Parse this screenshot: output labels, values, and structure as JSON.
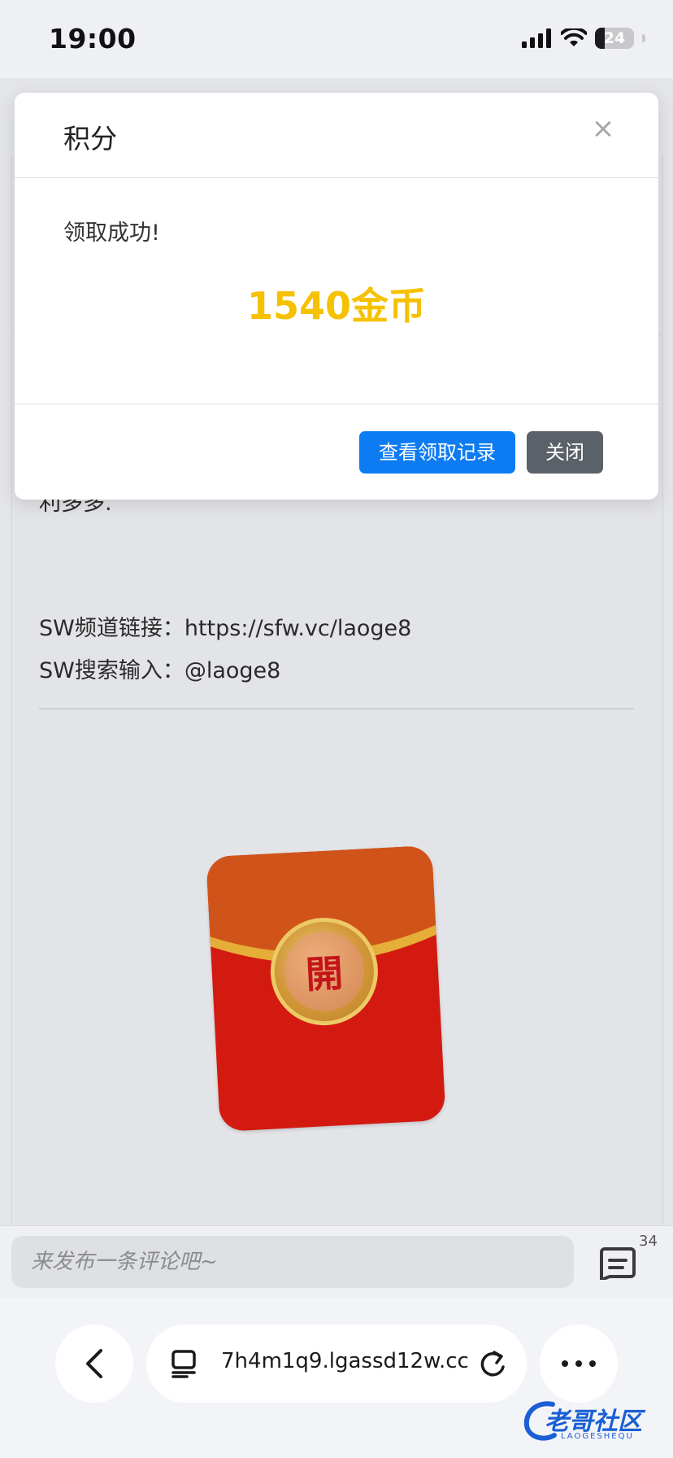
{
  "status_bar": {
    "time": "19:00",
    "battery": "24",
    "battery_level": 0.24
  },
  "page": {
    "partial_text": "利多多.",
    "lines": [
      "SW频道链接：https://sfw.vc/laoge8",
      "SW搜索输入：@laoge8"
    ],
    "envelope_glyph": "開"
  },
  "modal": {
    "title": "积分",
    "close_symbol": "×",
    "message": "领取成功!",
    "amount": "1540金币",
    "primary_button": "查看领取记录",
    "secondary_button": "关闭",
    "accent_color": "#f5c100",
    "primary_color": "#0d7cf2"
  },
  "comment_bar": {
    "placeholder": "来发布一条评论吧~",
    "count": "34"
  },
  "browser": {
    "url": "7h4m1q9.lgassd12w.cc",
    "more_label": "•••"
  },
  "watermark": {
    "text": "老哥社区",
    "sub": "LAOGESHEQU"
  }
}
